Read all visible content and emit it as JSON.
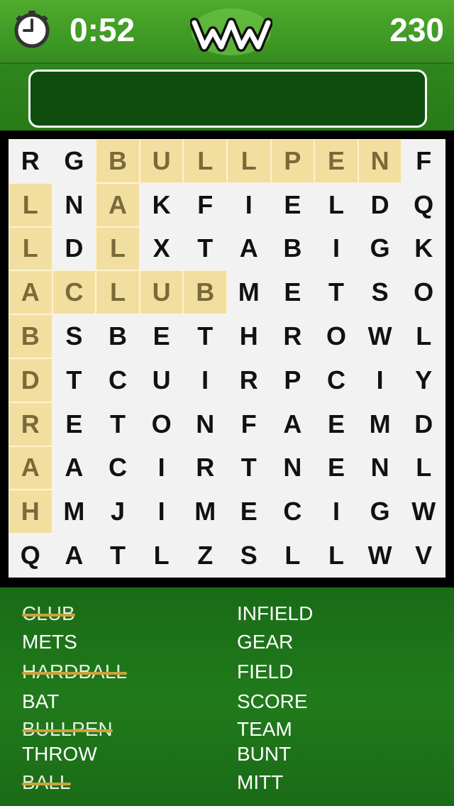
{
  "header": {
    "timer": "0:52",
    "score": "230",
    "logo_text": "WW",
    "icons": {
      "clock": "clock-icon",
      "logo": "ww-logo"
    }
  },
  "current_word": "",
  "grid": {
    "rows": [
      [
        "R",
        "G",
        "B",
        "U",
        "L",
        "L",
        "P",
        "E",
        "N",
        "F"
      ],
      [
        "L",
        "N",
        "A",
        "K",
        "F",
        "I",
        "E",
        "L",
        "D",
        "Q"
      ],
      [
        "L",
        "D",
        "L",
        "X",
        "T",
        "A",
        "B",
        "I",
        "G",
        "K"
      ],
      [
        "A",
        "C",
        "L",
        "U",
        "B",
        "M",
        "E",
        "T",
        "S",
        "O"
      ],
      [
        "B",
        "S",
        "B",
        "E",
        "T",
        "H",
        "R",
        "O",
        "W",
        "L"
      ],
      [
        "D",
        "T",
        "C",
        "U",
        "I",
        "R",
        "P",
        "C",
        "I",
        "Y"
      ],
      [
        "R",
        "E",
        "T",
        "O",
        "N",
        "F",
        "A",
        "E",
        "M",
        "D"
      ],
      [
        "A",
        "A",
        "C",
        "I",
        "R",
        "T",
        "N",
        "E",
        "N",
        "L"
      ],
      [
        "H",
        "M",
        "J",
        "I",
        "M",
        "E",
        "C",
        "I",
        "G",
        "W"
      ],
      [
        "Q",
        "A",
        "T",
        "L",
        "Z",
        "S",
        "L",
        "L",
        "W",
        "V"
      ]
    ],
    "highlighted": [
      [
        0,
        2
      ],
      [
        0,
        3
      ],
      [
        0,
        4
      ],
      [
        0,
        5
      ],
      [
        0,
        6
      ],
      [
        0,
        7
      ],
      [
        0,
        8
      ],
      [
        1,
        0
      ],
      [
        2,
        0
      ],
      [
        3,
        0
      ],
      [
        4,
        0
      ],
      [
        5,
        0
      ],
      [
        6,
        0
      ],
      [
        7,
        0
      ],
      [
        8,
        0
      ],
      [
        1,
        2
      ],
      [
        2,
        2
      ],
      [
        3,
        1
      ],
      [
        3,
        2
      ],
      [
        3,
        3
      ],
      [
        3,
        4
      ]
    ],
    "colors": {
      "highlight": "#f2dfa0",
      "highlight_text": "#7a6a3a",
      "strike": "#c9a33a"
    }
  },
  "words_left": [
    {
      "text": "CLUB",
      "found": true
    },
    {
      "text": "METS",
      "found": false
    },
    {
      "text": "HARDBALL",
      "found": true
    },
    {
      "text": "BAT",
      "found": false
    },
    {
      "text": "BULLPEN",
      "found": true
    },
    {
      "text": "THROW",
      "found": false
    },
    {
      "text": "BALL",
      "found": true
    }
  ],
  "words_right": [
    {
      "text": "INFIELD",
      "found": false
    },
    {
      "text": "GEAR",
      "found": false
    },
    {
      "text": "FIELD",
      "found": false
    },
    {
      "text": "SCORE",
      "found": false
    },
    {
      "text": "TEAM",
      "found": false
    },
    {
      "text": "BUNT",
      "found": false
    },
    {
      "text": "MITT",
      "found": false
    }
  ]
}
